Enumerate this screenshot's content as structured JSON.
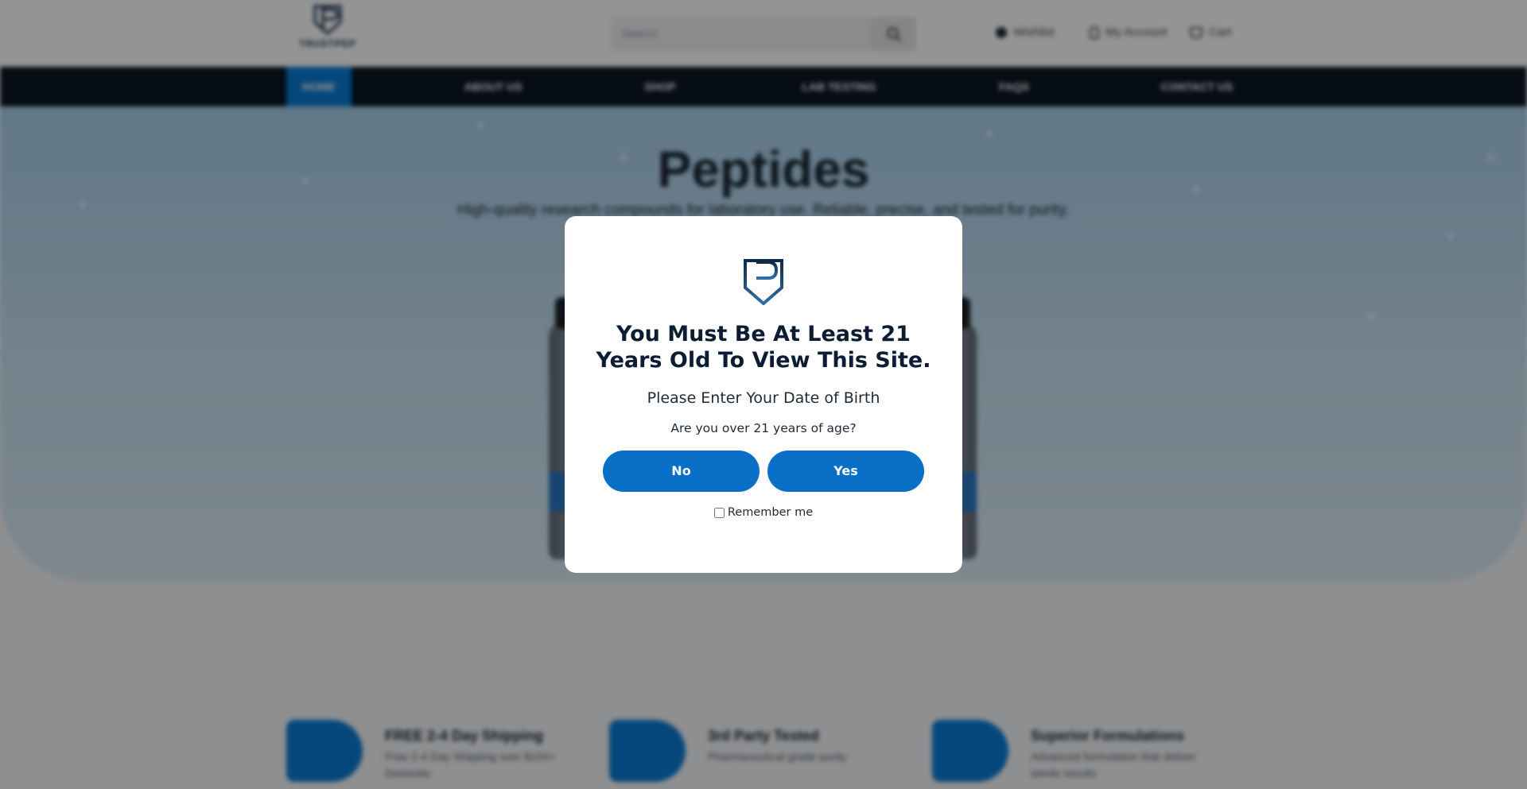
{
  "header": {
    "logo_text": "TRUSTPEP",
    "search_placeholder": "Search",
    "wishlist_label": "Wishlist",
    "account_label": "My Account",
    "cart_label": "Cart"
  },
  "nav": {
    "items": [
      {
        "label": "HOME",
        "active": true
      },
      {
        "label": "ABOUT US",
        "active": false
      },
      {
        "label": "SHOP",
        "active": false
      },
      {
        "label": "LAB TESTING",
        "active": false
      },
      {
        "label": "FAQS",
        "active": false
      },
      {
        "label": "CONTACT US",
        "active": false
      }
    ]
  },
  "hero": {
    "title": "Peptides",
    "subtitle": "High-quality research compounds for laboratory use. Reliable, precise, and tested for purity."
  },
  "features": [
    {
      "title": "FREE 2-4 Day Shipping",
      "description": "Free 2-4 Day Shipping over $150+ Domestic",
      "icon": "truck-icon"
    },
    {
      "title": "3rd Party Tested",
      "description": "Pharmaceutical grade purity",
      "icon": "flask-icon"
    },
    {
      "title": "Superior Formulations",
      "description": "Advanced formulation that deliver sterile results",
      "icon": "shield-icon"
    }
  ],
  "age_gate": {
    "title": "You Must Be At Least 21 Years Old To View This Site.",
    "subtitle": "Please Enter Your Date of Birth",
    "question": "Are you over 21 years of age?",
    "no_label": "No",
    "yes_label": "Yes",
    "remember_label": "Remember me",
    "remember_checked": false
  },
  "colors": {
    "accent": "#0a70c7",
    "nav_bg": "#0b1724",
    "brand_dark": "#0c1d33",
    "overlay": "rgba(0,0,0,0.42)"
  }
}
